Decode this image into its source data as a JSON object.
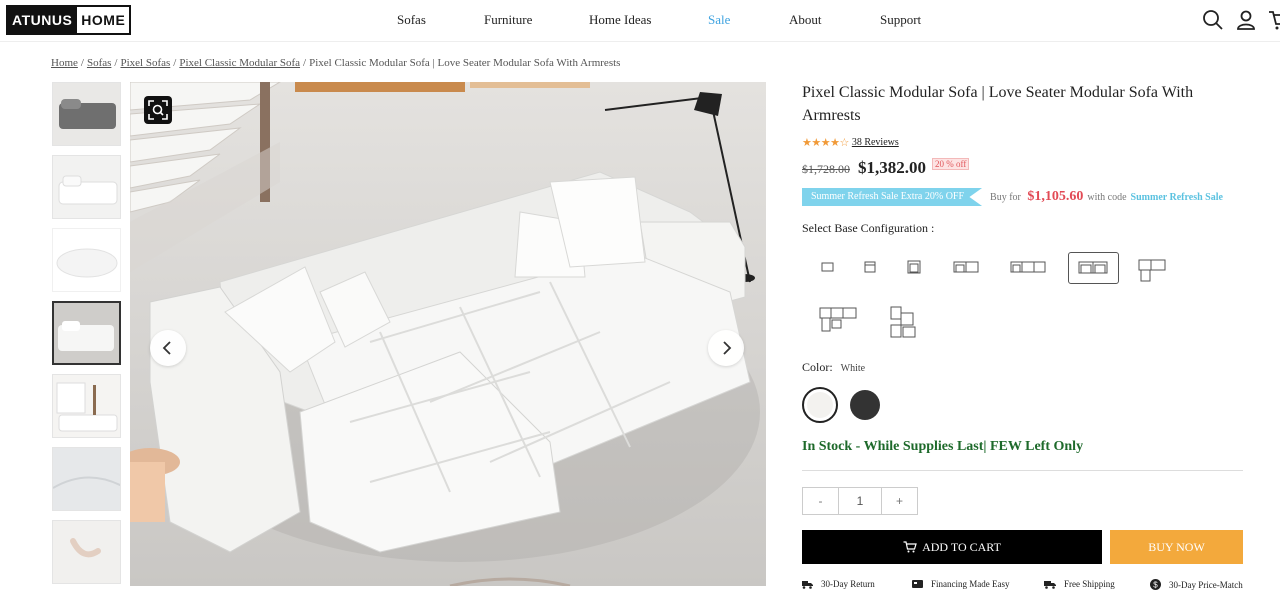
{
  "brand": {
    "logo_part1": "ATUNUS",
    "logo_part2": "HOME"
  },
  "nav": {
    "items": [
      "Sofas",
      "Furniture",
      "Home Ideas",
      "Sale",
      "About",
      "Support"
    ]
  },
  "header_icons": [
    "search-icon",
    "account-icon",
    "cart-icon"
  ],
  "breadcrumb": [
    {
      "label": "Home",
      "link": true
    },
    {
      "label": "Sofas",
      "link": true
    },
    {
      "label": "Pixel Sofas",
      "link": true
    },
    {
      "label": "Pixel Classic Modular Sofa",
      "link": true
    },
    {
      "label": "Pixel Classic Modular Sofa | Love Seater Modular Sofa With Armrests",
      "link": false
    }
  ],
  "product": {
    "title": "Pixel Classic Modular Sofa | Love Seater Modular Sofa With Armrests",
    "rating": 4.5,
    "reviews_label": "38 Reviews",
    "price_old": "$1,728.00",
    "price_new": "$1,382.00",
    "discount_label": "20 % off",
    "promo_tag": "Summer Refresh Sale Extra 20% OFF",
    "buy_for_label": "Buy for",
    "buy_for_price": "$1,105.60",
    "with_code_label": "with code",
    "promo_code": "Summer Refresh Sale",
    "config_label": "Select Base Configuration :",
    "config_selected_index": 5,
    "color_label": "Color:",
    "color_value": "White",
    "colors": [
      {
        "name": "White",
        "hex": "#f3f2ef"
      },
      {
        "name": "Dark Grey",
        "hex": "#333333"
      }
    ],
    "stock_text": "In Stock - While Supplies Last| FEW Left Only",
    "quantity": "1",
    "qty_minus": "-",
    "qty_plus": "+",
    "add_to_cart": "ADD TO CART",
    "buy_now": "BUY NOW",
    "features": [
      "30-Day Return",
      "Financing Made Easy",
      "Free Shipping",
      "30-Day Price-Match"
    ]
  },
  "colors": {
    "accent_sale": "#3fa3e0",
    "star": "#f19a38",
    "promo_tag": "#7fd3ec",
    "buy_for_price": "#e24a55",
    "stock": "#1e6a2b",
    "buy_now": "#f3a93c"
  }
}
